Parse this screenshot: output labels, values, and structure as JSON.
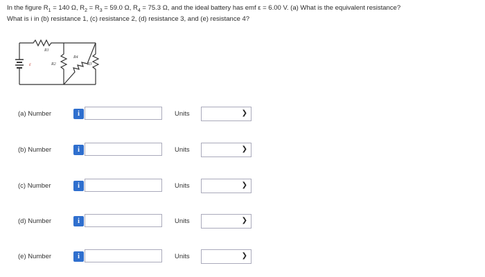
{
  "question": {
    "line1_pre": "In the figure R",
    "r1_sub": "1",
    "r1_val": " = 140 Ω, R",
    "r2_sub": "2",
    "r2_mid": " = R",
    "r3_sub": "3",
    "r3_val": " = 59.0 Ω, R",
    "r4_sub": "4",
    "r4_val": " = 75.3 Ω, and the ideal battery has emf ε = 6.00 V. (a) What is the equivalent resistance?",
    "line2": "What is i in (b) resistance 1, (c) resistance 2, (d) resistance 3, and (e) resistance 4?"
  },
  "circuit": {
    "r1_label": "R1",
    "r2_label": "R2",
    "r3_label": "R3",
    "r4_label": "R4",
    "emf_label": "ε"
  },
  "parts": [
    {
      "label": "(a)  Number",
      "info": "i",
      "value": "",
      "units_label": "Units",
      "units_value": ""
    },
    {
      "label": "(b)  Number",
      "info": "i",
      "value": "",
      "units_label": "Units",
      "units_value": ""
    },
    {
      "label": "(c)  Number",
      "info": "i",
      "value": "",
      "units_label": "Units",
      "units_value": ""
    },
    {
      "label": "(d)  Number",
      "info": "i",
      "value": "",
      "units_label": "Units",
      "units_value": ""
    },
    {
      "label": "(e)  Number",
      "info": "i",
      "value": "",
      "units_label": "Units",
      "units_value": ""
    }
  ],
  "icons": {
    "info": "info-icon",
    "dropdown": "chevron-down-icon"
  }
}
